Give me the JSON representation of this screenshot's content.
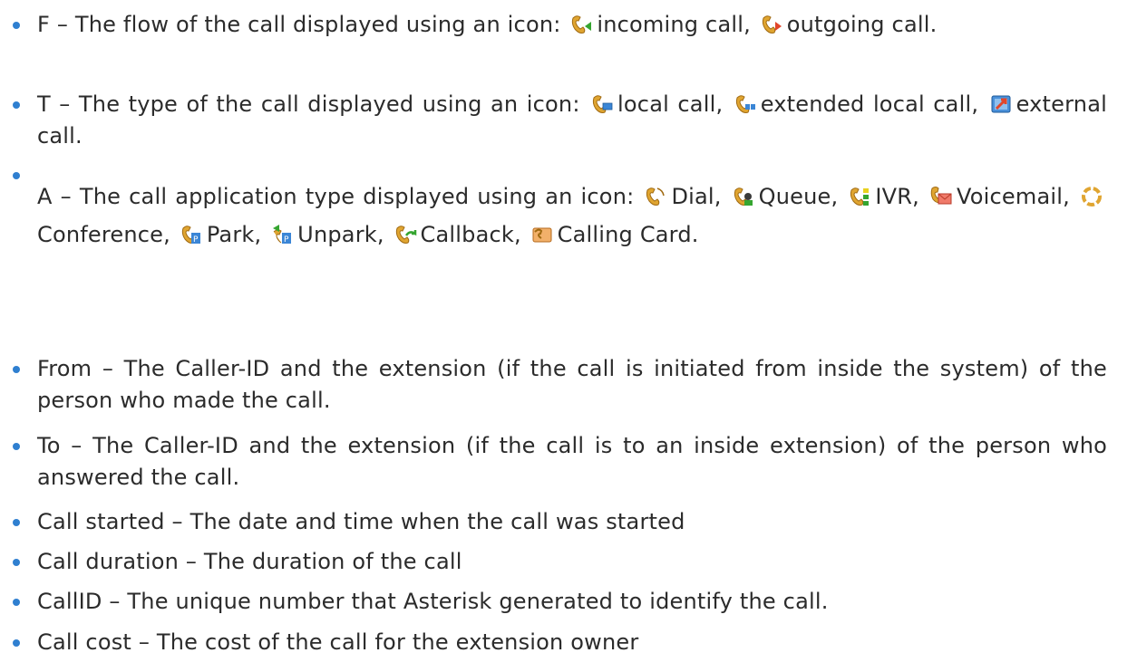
{
  "items": [
    {
      "prefix": "F – The flow of the call displayed using an icon:",
      "icons": [
        {
          "name": "incoming-call-icon",
          "label": "incoming call,"
        },
        {
          "name": "outgoing-call-icon",
          "label": "outgoing"
        }
      ],
      "suffix": "call."
    },
    {
      "prefix": "T – The type of the call displayed using an icon:",
      "icons": [
        {
          "name": "local-call-icon",
          "label": "local call,"
        },
        {
          "name": "extended-local-call-icon",
          "label": "extended"
        }
      ],
      "line2_prefix": "local call,",
      "icon3": {
        "name": "external-call-icon",
        "label": "external call."
      }
    },
    {
      "prefix": "A – The call application type displayed using an icon:",
      "apps": [
        {
          "name": "dial-icon",
          "label": "Dial,"
        },
        {
          "name": "queue-icon",
          "label": "Queue,"
        },
        {
          "name": "ivr-icon",
          "label": "IVR,"
        },
        {
          "name": "voicemail-icon",
          "label": "Voicemail,"
        },
        {
          "name": "conference-icon",
          "label": "Conference,"
        },
        {
          "name": "park-icon",
          "label": "Park,"
        },
        {
          "name": "unpark-icon",
          "label": "Unpark,"
        },
        {
          "name": "callback-icon",
          "label": "Callback,"
        },
        {
          "name": "calling-card-icon",
          "label": "Calling"
        }
      ],
      "suffix": "Card."
    },
    {
      "text": "From – The Caller-ID and the extension (if the call is initiated from inside the system) of the person who made the call."
    },
    {
      "text": "To – The Caller-ID and the extension (if the call is to an inside extension) of the person who answered the call."
    },
    {
      "text": "Call started – The date and time when the call was started"
    },
    {
      "text": "Call duration – The duration of the call"
    },
    {
      "text": "CallID – The unique number that Asterisk generated to identify the call."
    },
    {
      "text": "Call cost – The cost of the call for the extension owner"
    }
  ],
  "colors": {
    "bullet": "#2f7fd0",
    "text": "#2b2b2b",
    "handset": "#e0a531",
    "arrow_green": "#35a530",
    "arrow_red": "#e2462a"
  }
}
